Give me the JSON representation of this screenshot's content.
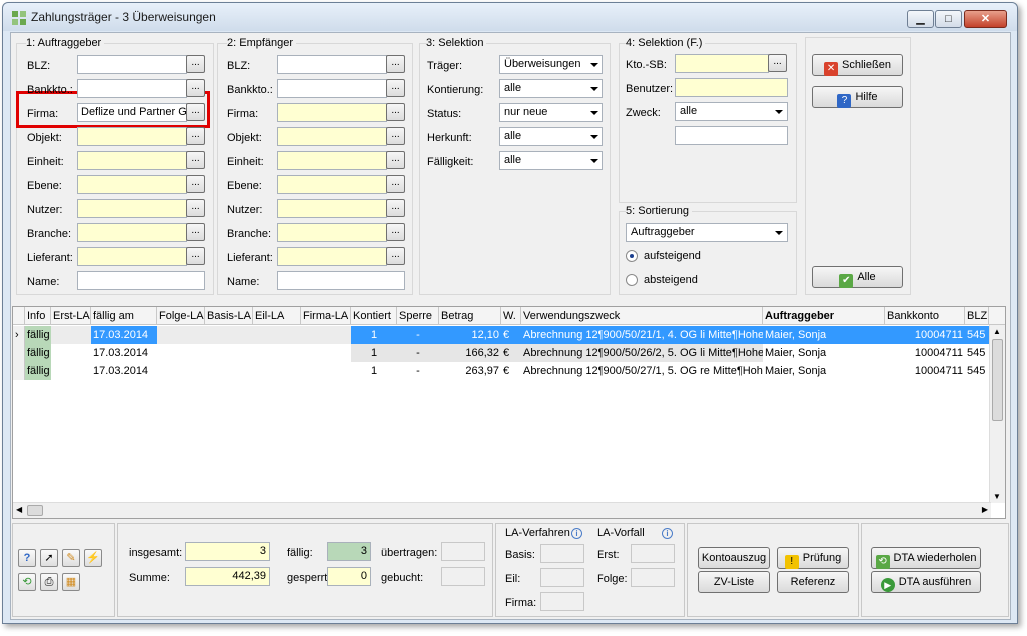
{
  "window": {
    "title": "Zahlungsträger - 3 Überweisungen",
    "min_label": "▁",
    "max_label": "□",
    "close_label": "✕"
  },
  "auftraggeber": {
    "title": "1: Auftraggeber",
    "fields": [
      {
        "label": "BLZ:",
        "value": ""
      },
      {
        "label": "Bankkto.:",
        "value": ""
      },
      {
        "label": "Firma:",
        "value": "Deflize und Partner Gı"
      },
      {
        "label": "Objekt:",
        "value": ""
      },
      {
        "label": "Einheit:",
        "value": ""
      },
      {
        "label": "Ebene:",
        "value": ""
      },
      {
        "label": "Nutzer:",
        "value": ""
      },
      {
        "label": "Branche:",
        "value": ""
      },
      {
        "label": "Lieferant:",
        "value": ""
      },
      {
        "label": "Name:",
        "value": ""
      }
    ]
  },
  "empfaenger": {
    "title": "2: Empfänger",
    "fields": [
      {
        "label": "BLZ:",
        "value": ""
      },
      {
        "label": "Bankkto.:",
        "value": ""
      },
      {
        "label": "Firma:",
        "value": ""
      },
      {
        "label": "Objekt:",
        "value": ""
      },
      {
        "label": "Einheit:",
        "value": ""
      },
      {
        "label": "Ebene:",
        "value": ""
      },
      {
        "label": "Nutzer:",
        "value": ""
      },
      {
        "label": "Branche:",
        "value": ""
      },
      {
        "label": "Lieferant:",
        "value": ""
      },
      {
        "label": "Name:",
        "value": ""
      }
    ]
  },
  "selektion": {
    "title": "3: Selektion",
    "fields": [
      {
        "label": "Träger:",
        "value": "Überweisungen"
      },
      {
        "label": "Kontierung:",
        "value": "alle"
      },
      {
        "label": "Status:",
        "value": "nur neue"
      },
      {
        "label": "Herkunft:",
        "value": "alle"
      },
      {
        "label": "Fälligkeit:",
        "value": "alle"
      }
    ]
  },
  "selektion_f": {
    "title": "4: Selektion (F.)",
    "kto_label": "Kto.-SB:",
    "kto_value": "",
    "benutzer_label": "Benutzer:",
    "benutzer_value": "",
    "zweck_label": "Zweck:",
    "zweck_value": "alle",
    "extra_value": ""
  },
  "sortierung": {
    "title": "5: Sortierung",
    "value": "Auftraggeber",
    "asc_label": "aufsteigend",
    "desc_label": "absteigend"
  },
  "actions": {
    "close_label": "Schließen",
    "help_label": "Hilfe",
    "all_label": "Alle"
  },
  "table": {
    "columns": [
      "Info",
      "Erst-LA",
      "fällig am",
      "Folge-LA",
      "Basis-LA",
      "Eil-LA",
      "Firma-LA",
      "Kontiert",
      "Sperre",
      "Betrag",
      "W.",
      "Verwendungszweck",
      "Auftraggeber",
      "Bankkonto",
      "BLZ"
    ],
    "rows": [
      {
        "info": "fällig",
        "erst": "",
        "faellig": "17.03.2014",
        "folge": "",
        "basis": "",
        "eil": "",
        "firma": "",
        "kontiert": "1",
        "sperre": "-",
        "betrag": "12,10",
        "w": "€",
        "zweck": "Abrechnung 12¶900/50/21/1, 4. OG li Mitte¶Hohe",
        "auftraggeber": "Maier, Sonja",
        "bankkonto": "10004711",
        "blz": "545"
      },
      {
        "info": "fällig",
        "erst": "",
        "faellig": "17.03.2014",
        "folge": "",
        "basis": "",
        "eil": "",
        "firma": "",
        "kontiert": "1",
        "sperre": "-",
        "betrag": "166,32",
        "w": "€",
        "zweck": "Abrechnung 12¶900/50/26/2, 5. OG li Mitte¶Hohe",
        "auftraggeber": "Maier, Sonja",
        "bankkonto": "10004711",
        "blz": "545"
      },
      {
        "info": "fällig",
        "erst": "",
        "faellig": "17.03.2014",
        "folge": "",
        "basis": "",
        "eil": "",
        "firma": "",
        "kontiert": "1",
        "sperre": "-",
        "betrag": "263,97",
        "w": "€",
        "zweck": "Abrechnung 12¶900/50/27/1, 5. OG re Mitte¶Hoh",
        "auftraggeber": "Maier, Sonja",
        "bankkonto": "10004711",
        "blz": "545"
      }
    ]
  },
  "summary": {
    "insgesamt_label": "insgesamt:",
    "insgesamt_value": "3",
    "summe_label": "Summe:",
    "summe_value": "442,39",
    "faellig_label": "fällig:",
    "faellig_value": "3",
    "gesperrt_label": "gesperrt:",
    "gesperrt_value": "0",
    "uebertragen_label": "übertragen:",
    "uebertragen_value": "",
    "gebucht_label": "gebucht:",
    "gebucht_value": ""
  },
  "la_verfahren": {
    "title": "LA-Verfahren",
    "basis_label": "Basis:",
    "eil_label": "Eil:",
    "firma_label": "Firma:"
  },
  "la_vorfall": {
    "title": "LA-Vorfall",
    "erst_label": "Erst:",
    "folge_label": "Folge:"
  },
  "bottom_buttons": {
    "kontoauszug": "Kontoauszug",
    "pruefung": "Prüfung",
    "zv_liste": "ZV-Liste",
    "referenz": "Referenz",
    "dta_wiederholen": "DTA wiederholen",
    "dta_ausfuehren": "DTA ausführen"
  },
  "colors": {
    "selected_row": "#3399ff",
    "yellow_field": "#ffffd2",
    "highlight_box": "#e00000"
  }
}
